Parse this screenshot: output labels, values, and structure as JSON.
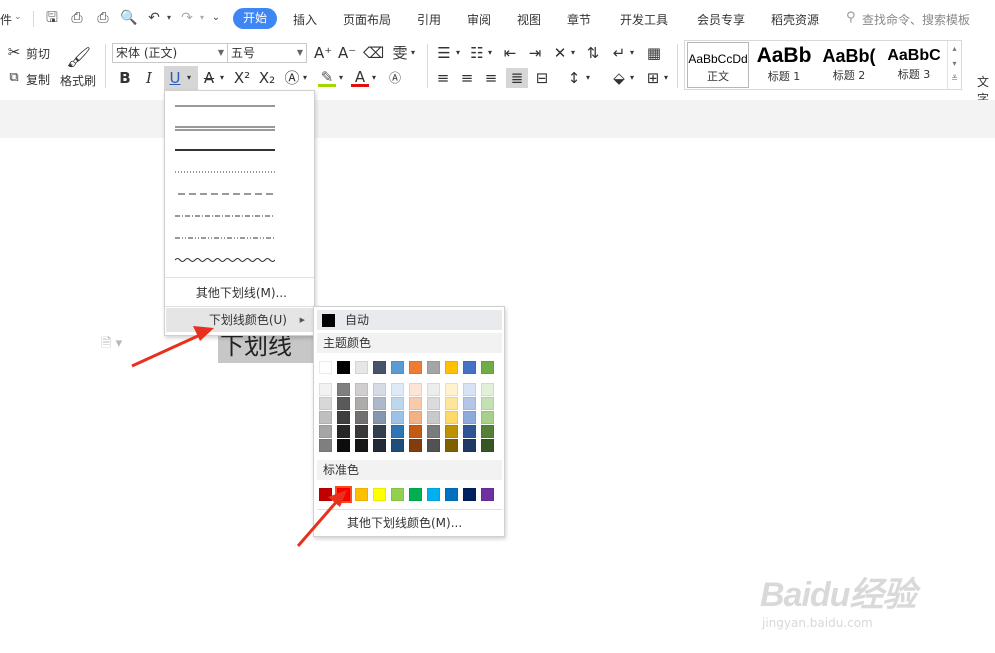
{
  "menubar": {
    "file_partial": "件",
    "tabs": [
      "开始",
      "插入",
      "页面布局",
      "引用",
      "审阅",
      "视图",
      "章节",
      "开发工具",
      "会员专享",
      "稻壳资源"
    ],
    "active_tab": "开始",
    "search_placeholder": "查找命令、搜索模板"
  },
  "ribbon": {
    "cut_label": "剪切",
    "copy_label": "复制",
    "format_painter_label": "格式刷",
    "font_name": "宋体 (正文)",
    "font_size": "五号",
    "styles": [
      {
        "sample": "AaBbCcDd",
        "name": "正文"
      },
      {
        "sample": "AaBb",
        "name": "标题 1"
      },
      {
        "sample": "AaBb(",
        "name": "标题 2"
      },
      {
        "sample": "AaBbC",
        "name": "标题 3"
      }
    ],
    "text_tool_partial": "文字"
  },
  "document": {
    "selected_text": "下划线"
  },
  "underline_menu": {
    "line_styles": [
      "single",
      "double",
      "thick",
      "dotted",
      "dashed",
      "dash-dot",
      "dash-dot-dot",
      "wave"
    ],
    "other_underline": "其他下划线(M)...",
    "underline_color": "下划线颜色(U)"
  },
  "color_menu": {
    "auto_label": "自动",
    "theme_colors_label": "主题颜色",
    "standard_colors_label": "标准色",
    "more_colors": "其他下划线颜色(M)...",
    "theme_top_row": [
      "#ffffff",
      "#000000",
      "#e7e6e6",
      "#44546a",
      "#5b9bd5",
      "#ed7d31",
      "#a5a5a5",
      "#ffc000",
      "#4472c4",
      "#70ad47"
    ],
    "theme_shades": [
      [
        "#f2f2f2",
        "#7f7f7f",
        "#d0cece",
        "#d6dce4",
        "#deebf6",
        "#fbe5d5",
        "#ededed",
        "#fff2cc",
        "#d9e2f3",
        "#e2efd9"
      ],
      [
        "#d8d8d8",
        "#595959",
        "#aeabab",
        "#adb9ca",
        "#bdd7ee",
        "#f7cbac",
        "#dbdbdb",
        "#fee599",
        "#b4c6e7",
        "#c5e0b3"
      ],
      [
        "#bfbfbf",
        "#3f3f3f",
        "#757070",
        "#8496b0",
        "#9cc3e5",
        "#f4b183",
        "#c9c9c9",
        "#ffd965",
        "#8eaadb",
        "#a8d08d"
      ],
      [
        "#a5a5a5",
        "#262626",
        "#3a3838",
        "#323f4f",
        "#2e75b5",
        "#c55a11",
        "#7b7b7b",
        "#bf9000",
        "#2f5496",
        "#538135"
      ],
      [
        "#7f7f7f",
        "#0c0c0c",
        "#171616",
        "#222a35",
        "#1e4e79",
        "#833c0b",
        "#525252",
        "#7f6000",
        "#1f3864",
        "#375623"
      ]
    ],
    "standard_colors": [
      "#c00000",
      "#ff0000",
      "#ffc000",
      "#ffff00",
      "#92d050",
      "#00b050",
      "#00b0f0",
      "#0070c0",
      "#002060",
      "#7030a0"
    ],
    "selected_standard_index": 1
  },
  "annotation": {
    "arrow_color": "#e8301e"
  },
  "watermark": {
    "brand": "Baidu经验",
    "url": "jingyan.baidu.com"
  }
}
